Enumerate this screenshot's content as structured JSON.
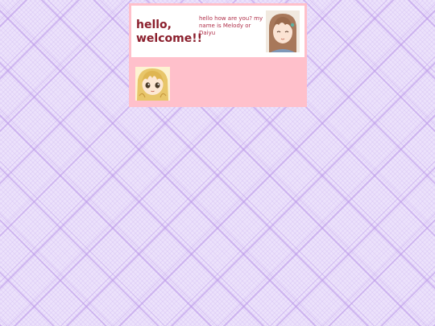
{
  "header": {
    "title": "hello, welcome!!",
    "intro": "hello how are you? my name is Melody or Daiyu"
  },
  "images": {
    "top_avatar": "anime-girl-brown-hair-avatar",
    "bottom_avatar": "anime-girl-blonde-hair-avatar"
  },
  "colors": {
    "page_background": "#ece2fb",
    "panel_background": "#ffc0cb",
    "title_color": "#8b1f2d",
    "text_color": "#b0304a"
  }
}
